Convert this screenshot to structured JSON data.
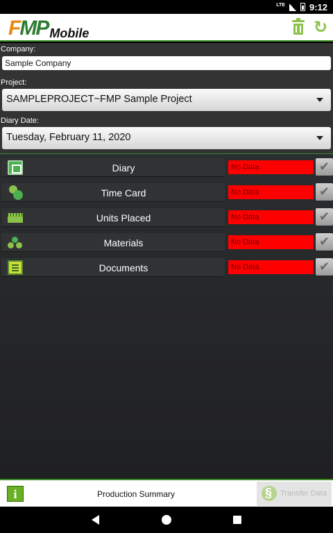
{
  "status_bar": {
    "network": "LTE",
    "time": "9:12"
  },
  "app": {
    "logo_fmp_f": "F",
    "logo_fmp_mp": "MP",
    "logo_mobile": "Mobile"
  },
  "header": {
    "trash_icon": "trash-icon",
    "refresh_icon": "refresh-icon",
    "refresh_glyph": "↻"
  },
  "form": {
    "company_label": "Company:",
    "company_value": "Sample Company",
    "project_label": "Project:",
    "project_value": "SAMPLEPROJECT~FMP Sample Project",
    "date_label": "Diary Date:",
    "date_value": "Tuesday, February 11, 2020"
  },
  "modules": [
    {
      "label": "Diary",
      "icon": "diary-icon",
      "status": "No Data",
      "check": "✔"
    },
    {
      "label": "Time Card",
      "icon": "people-icon",
      "status": "No Data",
      "check": "✔"
    },
    {
      "label": "Units Placed",
      "icon": "ruler-icon",
      "status": "No Data",
      "check": "✔"
    },
    {
      "label": "Materials",
      "icon": "materials-icon",
      "status": "No Data",
      "check": "✔"
    },
    {
      "label": "Documents",
      "icon": "clipboard-icon",
      "status": "No Data",
      "check": "✔"
    }
  ],
  "colors": {
    "accent_green": "#3a8a22",
    "status_red": "#fe0000"
  },
  "bottom_bar": {
    "info_glyph": "i",
    "summary_label": "Production Summary",
    "transfer_label": "Transfer Data"
  }
}
